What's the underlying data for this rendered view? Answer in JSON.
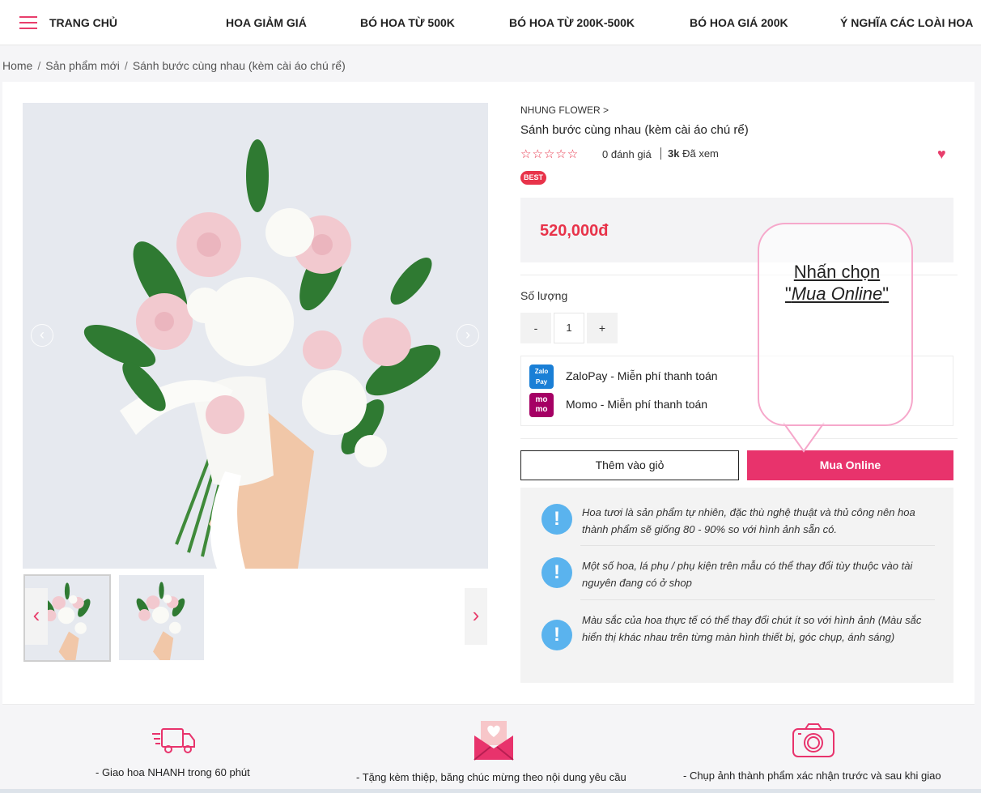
{
  "nav": {
    "home": "TRANG CHỦ",
    "items": [
      "HOA GIẢM GIÁ",
      "BÓ HOA TỪ 500K",
      "BÓ HOA TỪ 200K-500K",
      "BÓ HOA GIÁ 200K",
      "Ý NGHĨA CÁC LOÀI HOA"
    ]
  },
  "breadcrumb": [
    "Home",
    "Sản phẩm mới",
    "Sánh bước cùng nhau (kèm cài áo chú rể)"
  ],
  "product": {
    "brand": "NHUNG FLOWER >",
    "title": "Sánh bước cùng nhau (kèm cài áo chú rể)",
    "stars": "☆☆☆☆☆",
    "rating_count": "0 đánh giá",
    "views_count": "3k",
    "views_label": "Đã xem",
    "badge": "BEST",
    "price": "520,000đ"
  },
  "quantity": {
    "label": "Số lượng",
    "minus": "-",
    "value": "1",
    "plus": "+"
  },
  "payments": [
    {
      "name": "ZaloPay - Miễn phí thanh toán",
      "logo_text": "Zalo Pay",
      "color": "#1a7fd6"
    },
    {
      "name": "Momo - Miễn phí thanh toán",
      "logo_text": "mo mo",
      "color": "#a50064"
    }
  ],
  "actions": {
    "add_to_cart": "Thêm vào giỏ",
    "buy_online": "Mua Online"
  },
  "notes": [
    "Hoa tươi là sản phẩm tự nhiên, đặc thù nghệ thuật và thủ công nên hoa thành phẩm sẽ giống 80 - 90% so với hình ảnh sẵn có.",
    "Một số hoa, lá phụ / phụ kiện trên mẫu có thể thay đổi tùy thuộc vào tài nguyên đang có ở shop",
    "Màu sắc của hoa thực tế có thể thay đổi chút ít so với hình ảnh (Màu sắc hiển thị khác nhau trên từng màn hình thiết bị, góc chụp, ánh sáng)"
  ],
  "callout": {
    "line1": "Nhấn chọn",
    "line2_quote_open": "\"",
    "line2_italic": "Mua Online",
    "line2_quote_close": "\""
  },
  "features": [
    "- Giao hoa NHANH trong 60 phút",
    "- Tặng kèm thiệp, băng chúc mừng theo nội dung yêu cầu",
    "- Chụp ảnh thành phẩm xác nhận trước và sau khi giao"
  ],
  "colors": {
    "accent": "#e8336c",
    "star": "#e8334a",
    "info": "#5ab3ee"
  }
}
